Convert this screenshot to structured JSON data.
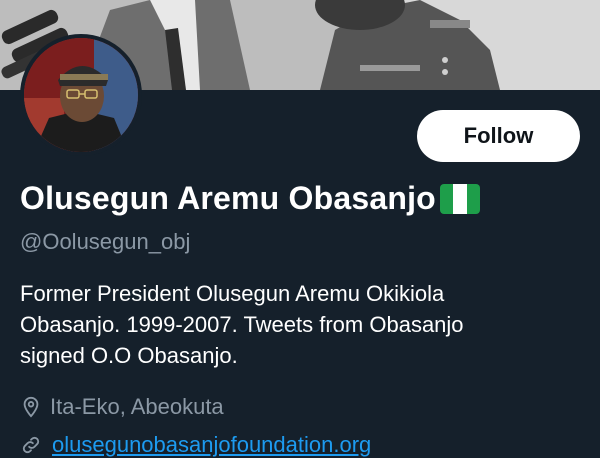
{
  "profile": {
    "name": "Olusegun Aremu Obasanjo",
    "handle": "@Oolusegun_obj",
    "bio_lines": [
      "Former President Olusegun Aremu Okikiola",
      "Obasanjo. 1999-2007. Tweets from Obasanjo",
      "signed O.O Obasanjo."
    ],
    "location": "Ita-Eko, Abeokuta",
    "website": "olusegunobasanjofoundation.org",
    "verified_flag": "nigeria-flag-emoji"
  },
  "actions": {
    "follow_label": "Follow"
  },
  "colors": {
    "background": "#15202b",
    "link": "#1d9bf0",
    "muted": "#8b98a5",
    "flag_green": "#1e9e4a",
    "flag_white": "#ffffff"
  }
}
